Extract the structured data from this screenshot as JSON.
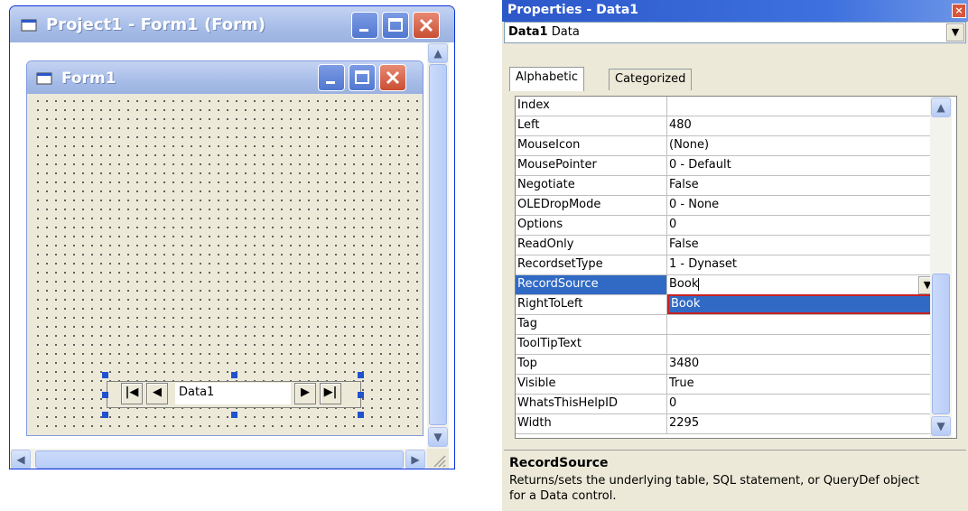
{
  "project_window": {
    "title": "Project1 - Form1 (Form)",
    "form_window": {
      "title": "Form1",
      "data_control": {
        "caption": "Data1"
      }
    }
  },
  "properties_window": {
    "title": "Properties - Data1",
    "object_selector": {
      "name": "Data1",
      "type": "Data"
    },
    "tabs": [
      "Alphabetic",
      "Categorized"
    ],
    "active_tab": "Alphabetic",
    "properties": [
      {
        "name": "Index",
        "value": ""
      },
      {
        "name": "Left",
        "value": "480"
      },
      {
        "name": "MouseIcon",
        "value": "(None)"
      },
      {
        "name": "MousePointer",
        "value": "0 - Default"
      },
      {
        "name": "Negotiate",
        "value": "False"
      },
      {
        "name": "OLEDropMode",
        "value": "0 - None"
      },
      {
        "name": "Options",
        "value": "0"
      },
      {
        "name": "ReadOnly",
        "value": "False"
      },
      {
        "name": "RecordsetType",
        "value": "1 - Dynaset"
      },
      {
        "name": "RecordSource",
        "value": "Book"
      },
      {
        "name": "RightToLeft",
        "value": ""
      },
      {
        "name": "Tag",
        "value": ""
      },
      {
        "name": "ToolTipText",
        "value": ""
      },
      {
        "name": "Top",
        "value": "3480"
      },
      {
        "name": "Visible",
        "value": "True"
      },
      {
        "name": "WhatsThisHelpID",
        "value": "0"
      },
      {
        "name": "Width",
        "value": "2295"
      }
    ],
    "selected_property": "RecordSource",
    "dropdown_items": [
      "Book"
    ],
    "description": {
      "title": "RecordSource",
      "text": "Returns/sets the underlying table, SQL statement, or QueryDef object for a Data control."
    }
  },
  "colors": {
    "title_active": "#316ac5",
    "selection": "#316ac5",
    "window_bg": "#ece9d8",
    "close_button": "#d9563a"
  }
}
